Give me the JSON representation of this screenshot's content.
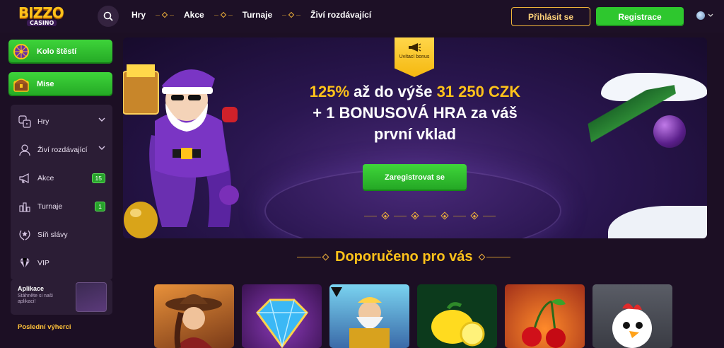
{
  "header": {
    "logo_top": "BIZZO",
    "logo_bottom": "CASINO",
    "nav": [
      "Hry",
      "Akce",
      "Turnaje",
      "Živí rozdávající"
    ],
    "login_label": "Přihlásit se",
    "register_label": "Registrace"
  },
  "sidebar": {
    "wheel_label": "Kolo štěstí",
    "missions_label": "Mise",
    "items": [
      {
        "label": "Hry",
        "icon": "games-icon",
        "chevron": true
      },
      {
        "label": "Živí rozdávající",
        "icon": "live-dealer-icon",
        "chevron": true
      },
      {
        "label": "Akce",
        "icon": "megaphone-icon",
        "badge": "15"
      },
      {
        "label": "Turnaje",
        "icon": "tournament-icon",
        "badge": "1"
      },
      {
        "label": "Síň slávy",
        "icon": "laurel-icon"
      },
      {
        "label": "VIP",
        "icon": "diamond-icon"
      }
    ],
    "app_title": "Aplikace",
    "app_sub": "Stáhněte si naši aplikaci!",
    "winners_title": "Poslední výherci"
  },
  "banner": {
    "tag_text": "Uvítací bonus",
    "line1_hl1": "125%",
    "line1_mid": " až do výše ",
    "line1_hl2": "31 250 CZK",
    "line2": "+ 1 BONUSOVÁ HRA za váš",
    "line3": "první vklad",
    "cta_label": "Zaregistrovat se"
  },
  "recommended": {
    "title": "Doporučeno pro vás"
  },
  "colors": {
    "accent_gold": "#ffc21a",
    "green": "#2ec72e",
    "bg": "#1c0f24"
  }
}
